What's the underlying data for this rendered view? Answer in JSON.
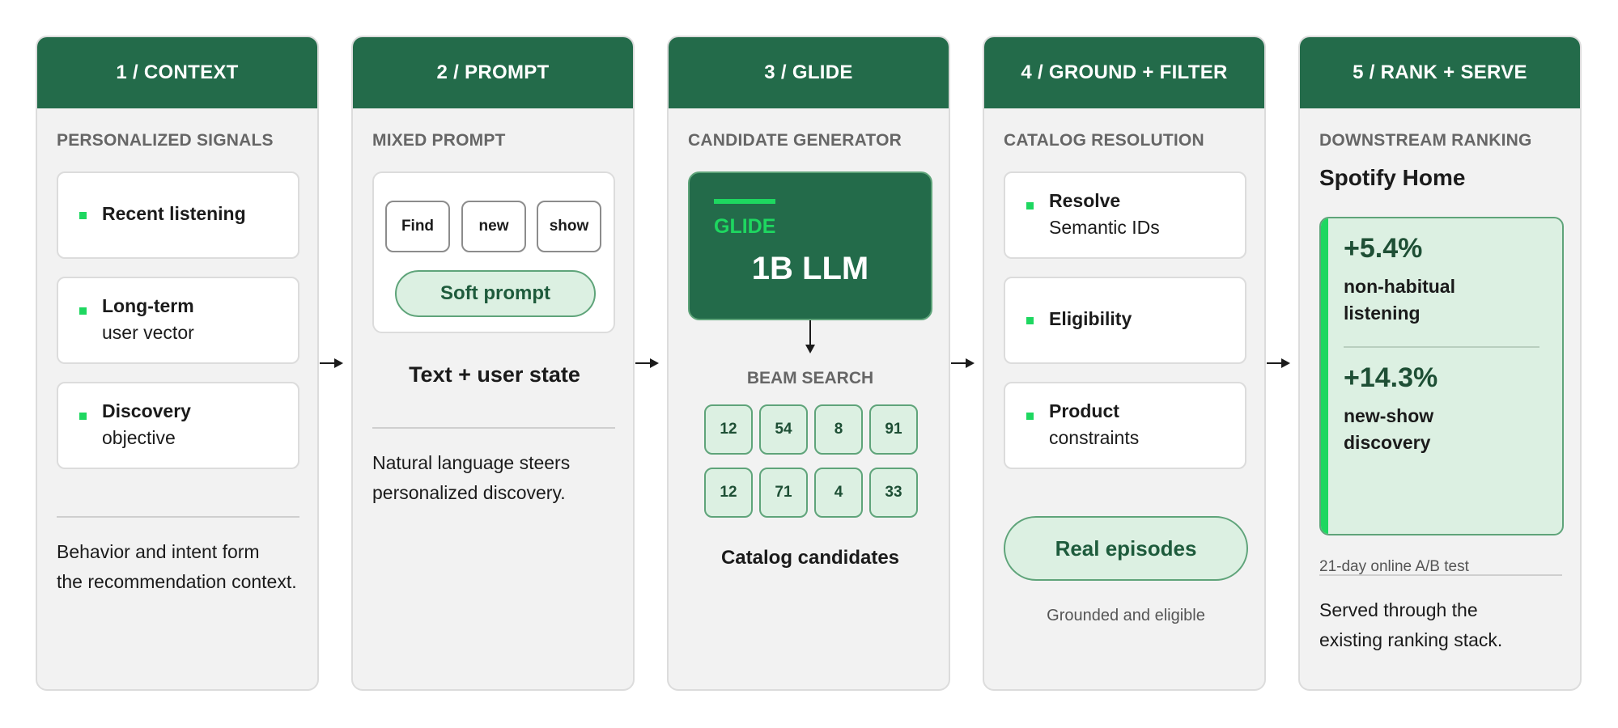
{
  "stages": [
    {
      "title": "1 / CONTEXT",
      "section_label": "PERSONALIZED SIGNALS",
      "cards": [
        {
          "title": "Recent listening",
          "subtitle": ""
        },
        {
          "title": "Long-term",
          "subtitle": "user vector"
        },
        {
          "title": "Discovery",
          "subtitle": "objective"
        }
      ],
      "description": [
        "Behavior and intent form",
        "the recommendation context."
      ]
    },
    {
      "title": "2 / PROMPT",
      "section_label": "MIXED PROMPT",
      "tokens": [
        "Find",
        "new",
        "show"
      ],
      "soft_prompt": "Soft prompt",
      "caption": "Text + user state",
      "description": [
        "Natural language steers",
        "personalized discovery."
      ]
    },
    {
      "title": "3 / GLIDE",
      "section_label": "CANDIDATE GENERATOR",
      "model_name": "GLIDE",
      "model_size": "1B LLM",
      "beam_label": "BEAM SEARCH",
      "beam_rows": [
        [
          "12",
          "54",
          "8",
          "91"
        ],
        [
          "12",
          "71",
          "4",
          "33"
        ]
      ],
      "caption": "Catalog candidates"
    },
    {
      "title": "4 / GROUND + FILTER",
      "section_label": "CATALOG RESOLUTION",
      "cards": [
        {
          "title": "Resolve",
          "subtitle": "Semantic IDs"
        },
        {
          "title": "Eligibility",
          "subtitle": ""
        },
        {
          "title": "Product",
          "subtitle": "constraints"
        }
      ],
      "result_pill": "Real episodes",
      "caption": "Grounded and eligible"
    },
    {
      "title": "5 / RANK + SERVE",
      "section_label": "DOWNSTREAM RANKING",
      "surface": "Spotify Home",
      "metrics": [
        {
          "value": "+5.4%",
          "label": [
            "non-habitual",
            "listening"
          ]
        },
        {
          "value": "+14.3%",
          "label": [
            "new-show",
            "discovery"
          ]
        }
      ],
      "test_note": "21-day online A/B test",
      "description": [
        "Served through the",
        "existing ranking stack."
      ]
    }
  ],
  "colors": {
    "header_green": "#236b4a",
    "accent_green": "#1ed760",
    "light_green": "#dcf0e2",
    "panel_bg": "#f2f2f2"
  }
}
